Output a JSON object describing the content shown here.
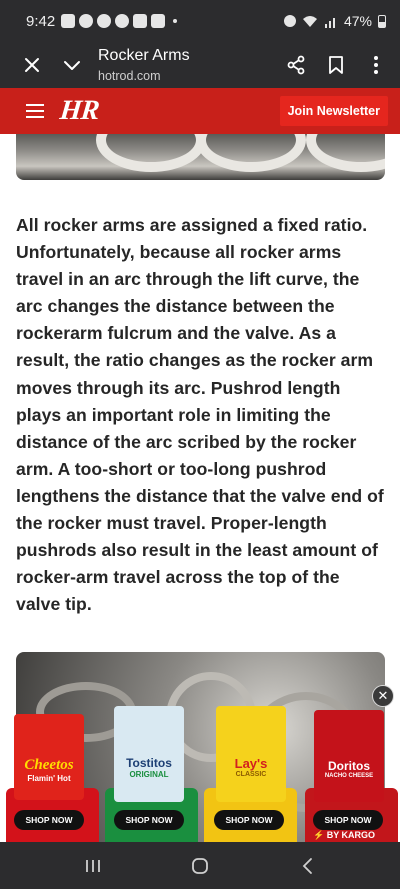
{
  "status_bar": {
    "time": "9:42",
    "battery": "47%"
  },
  "browser": {
    "title": "Rocker Arms",
    "domain": "hotrod.com"
  },
  "site_header": {
    "logo": "HR",
    "join_label": "Join Newsletter"
  },
  "article": {
    "paragraph": "All rocker arms are assigned a fixed ratio. Unfortunately, because all rocker arms travel in an arc through the lift curve, the arc changes the distance between the rockerarm fulcrum and the valve. As a result, the ratio changes as the rocker arm moves through its arc. Pushrod length plays an important role in limiting the distance of the arc scribed by the rocker arm. A too-short or too-long pushrod lengthens the distance that the valve end of the rocker must travel. Proper-length pushrods also result in the least amount of rocker-arm travel across the top of the valve tip."
  },
  "ad": {
    "products": [
      {
        "brand": "Cheetos",
        "sub": "Flamin' Hot",
        "shop": "SHOP NOW",
        "bag_color": "#e0231b",
        "tile_color": "#d3121a"
      },
      {
        "brand": "Tostitos",
        "sub": "ORIGINAL",
        "shop": "SHOP NOW",
        "bag_color": "#d9e9f2",
        "tile_color": "#1a8f3f"
      },
      {
        "brand": "Lay's",
        "sub": "CLASSIC",
        "shop": "SHOP NOW",
        "bag_color": "#f5d21c",
        "tile_color": "#f2c413"
      },
      {
        "brand": "Doritos",
        "sub": "NACHO CHEESE",
        "shop": "SHOP NOW",
        "bag_color": "#c4121a",
        "tile_color": "#c2161b"
      }
    ],
    "attribution": "⚡ BY KARGO"
  }
}
